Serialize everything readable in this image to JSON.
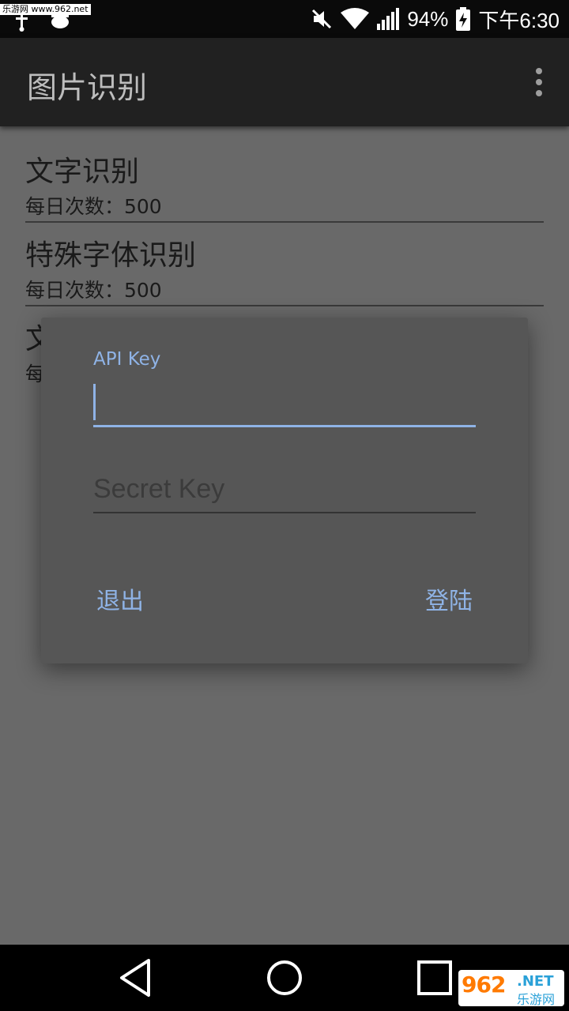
{
  "watermark_top": "乐游网 www.962.net",
  "status": {
    "battery": "94%",
    "time": "下午6:30"
  },
  "appbar": {
    "title": "图片识别"
  },
  "list": [
    {
      "title": "文字识别",
      "subtitle": "每日次数：500"
    },
    {
      "title": "特殊字体识别",
      "subtitle": "每日次数：500"
    },
    {
      "title": "文",
      "subtitle": "每"
    }
  ],
  "dialog": {
    "api_key_label": "API Key",
    "api_key_value": "",
    "secret_key_placeholder": "Secret Key",
    "exit_label": "退出",
    "login_label": "登陆"
  },
  "watermark_bottom": {
    "big": "962",
    "net": ".NET",
    "cn": "乐游网"
  },
  "colors": {
    "accent": "#8fb3e6",
    "appbar": "#212121",
    "scrim": "#696969",
    "dialog": "#565656"
  }
}
